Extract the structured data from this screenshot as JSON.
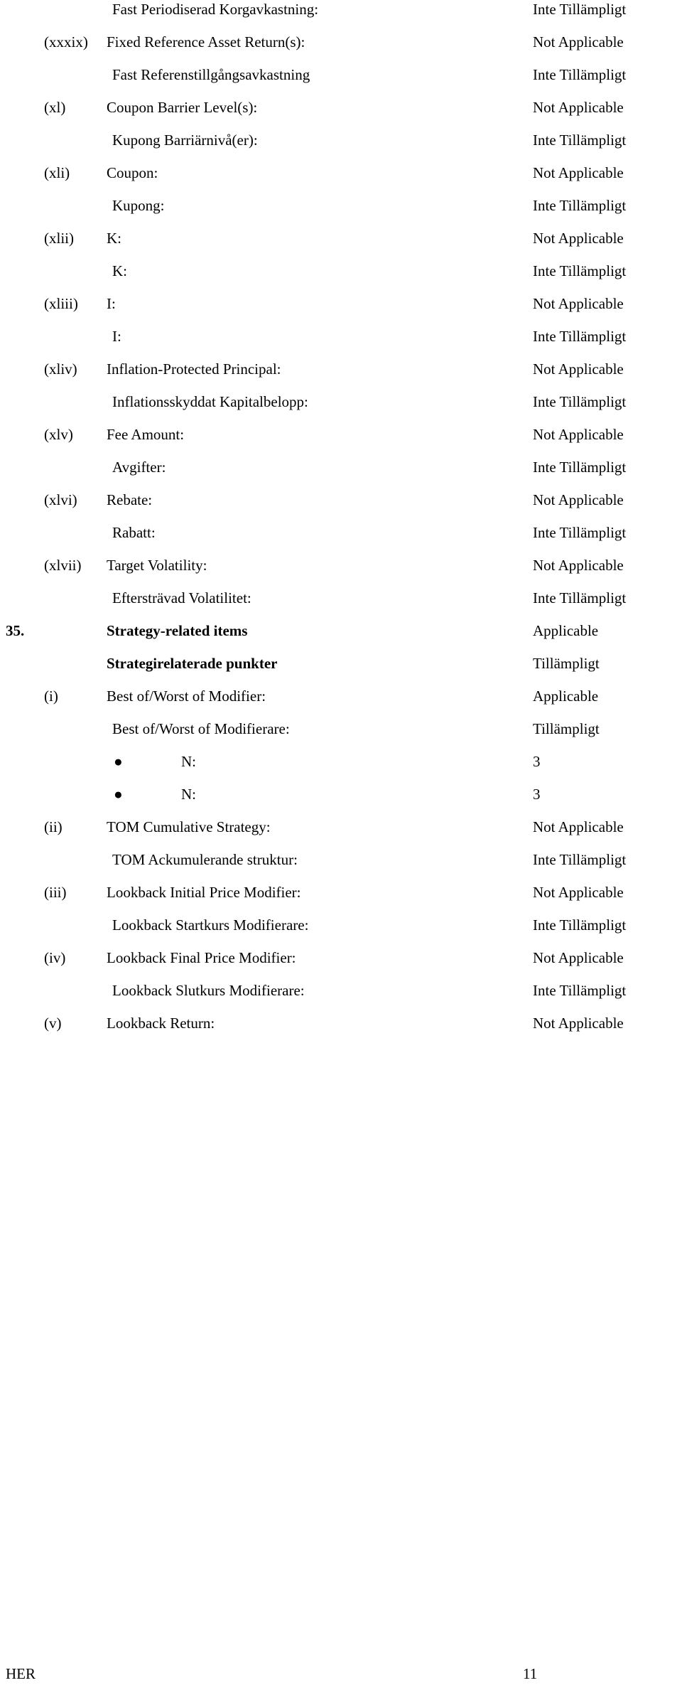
{
  "document": {
    "footer_left": "HER",
    "page_number": "11"
  },
  "rows": [
    {
      "num": "",
      "label": "Fast Periodiserad Korgavkastning:",
      "value": "Inte Tillämpligt",
      "indent": "ind2",
      "style": "normal",
      "kind": "row"
    },
    {
      "num": "(xxxix)",
      "label": "Fixed Reference Asset Return(s):",
      "value": "Not Applicable",
      "indent": "ind1",
      "style": "normal",
      "kind": "row"
    },
    {
      "num": "",
      "label": "Fast Referenstillgångsavkastning",
      "value": "Inte Tillämpligt",
      "indent": "ind2",
      "style": "normal",
      "kind": "row"
    },
    {
      "num": "(xl)",
      "label": "Coupon Barrier Level(s):",
      "value": "Not Applicable",
      "indent": "ind1",
      "style": "normal",
      "kind": "row"
    },
    {
      "num": "",
      "label": "Kupong Barriärnivå(er):",
      "value": "Inte Tillämpligt",
      "indent": "ind2",
      "style": "normal",
      "kind": "row"
    },
    {
      "num": "(xli)",
      "label": "Coupon:",
      "value": "Not Applicable",
      "indent": "ind1",
      "style": "normal",
      "kind": "row"
    },
    {
      "num": "",
      "label": "Kupong:",
      "value": "Inte Tillämpligt",
      "indent": "ind2",
      "style": "normal",
      "kind": "row"
    },
    {
      "num": "(xlii)",
      "label": "K:",
      "value": "Not Applicable",
      "indent": "ind1",
      "style": "normal",
      "kind": "row"
    },
    {
      "num": "",
      "label": "K:",
      "value": "Inte Tillämpligt",
      "indent": "ind2",
      "style": "normal",
      "kind": "row"
    },
    {
      "num": "(xliii)",
      "label": "I:",
      "value": "Not Applicable",
      "indent": "ind1",
      "style": "normal",
      "kind": "row"
    },
    {
      "num": "",
      "label": "I:",
      "value": "Inte Tillämpligt",
      "indent": "ind2",
      "style": "normal",
      "kind": "row"
    },
    {
      "num": "(xliv)",
      "label": "Inflation-Protected Principal:",
      "value": "Not Applicable",
      "indent": "ind1",
      "style": "normal",
      "kind": "row"
    },
    {
      "num": "",
      "label": "Inflationsskyddat Kapitalbelopp:",
      "value": "Inte Tillämpligt",
      "indent": "ind2",
      "style": "normal",
      "kind": "row"
    },
    {
      "num": "(xlv)",
      "label": "Fee Amount:",
      "value": "Not Applicable",
      "indent": "ind1",
      "style": "normal",
      "kind": "row"
    },
    {
      "num": "",
      "label": "Avgifter:",
      "value": "Inte Tillämpligt",
      "indent": "ind2",
      "style": "normal",
      "kind": "row"
    },
    {
      "num": "(xlvi)",
      "label": "Rebate:",
      "value": "Not Applicable",
      "indent": "ind1",
      "style": "normal",
      "kind": "row"
    },
    {
      "num": "",
      "label": "Rabatt:",
      "value": "Inte Tillämpligt",
      "indent": "ind2",
      "style": "normal",
      "kind": "row"
    },
    {
      "num": "(xlvii)",
      "label": "Target Volatility:",
      "value": "Not Applicable",
      "indent": "ind1",
      "style": "normal",
      "kind": "row"
    },
    {
      "num": "",
      "label": "Eftersträvad Volatilitet:",
      "value": "Inte Tillämpligt",
      "indent": "ind2",
      "style": "normal",
      "kind": "row"
    },
    {
      "num": "35.",
      "label": "Strategy-related items",
      "value": "Applicable",
      "indent": "ind1",
      "style": "bold",
      "kind": "section"
    },
    {
      "num": "",
      "label": "Strategirelaterade punkter",
      "value": "Tillämpligt",
      "indent": "ind1",
      "style": "bold",
      "kind": "section"
    },
    {
      "num": "(i)",
      "label": "Best of/Worst of Modifier:",
      "value": "Applicable",
      "indent": "ind1",
      "style": "normal",
      "kind": "row"
    },
    {
      "num": "",
      "label": "Best of/Worst of Modifierare:",
      "value": "Tillämpligt",
      "indent": "ind2",
      "style": "normal",
      "kind": "row"
    },
    {
      "num": "",
      "label": "N:",
      "value": "3",
      "indent": "ind3",
      "style": "normal",
      "kind": "bullet"
    },
    {
      "num": "",
      "label": "N:",
      "value": "3",
      "indent": "ind3",
      "style": "normal",
      "kind": "bullet"
    },
    {
      "num": "(ii)",
      "label": "TOM Cumulative Strategy:",
      "value": "Not Applicable",
      "indent": "ind1",
      "style": "normal",
      "kind": "row"
    },
    {
      "num": "",
      "label": "TOM Ackumulerande struktur:",
      "value": "Inte Tillämpligt",
      "indent": "ind2",
      "style": "normal",
      "kind": "row"
    },
    {
      "num": "(iii)",
      "label": "Lookback Initial Price Modifier:",
      "value": "Not Applicable",
      "indent": "ind1",
      "style": "normal",
      "kind": "row"
    },
    {
      "num": "",
      "label": "Lookback Startkurs Modifierare:",
      "value": "Inte Tillämpligt",
      "indent": "ind2",
      "style": "normal",
      "kind": "row"
    },
    {
      "num": "(iv)",
      "label": "Lookback Final Price Modifier:",
      "value": "Not Applicable",
      "indent": "ind1",
      "style": "normal",
      "kind": "row"
    },
    {
      "num": "",
      "label": "Lookback Slutkurs Modifierare:",
      "value": "Inte Tillämpligt",
      "indent": "ind2",
      "style": "normal",
      "kind": "row"
    },
    {
      "num": "(v)",
      "label": "Lookback Return:",
      "value": "Not Applicable",
      "indent": "ind1",
      "style": "normal",
      "kind": "row"
    }
  ],
  "icons": {
    "bullet_glyph": "●"
  }
}
